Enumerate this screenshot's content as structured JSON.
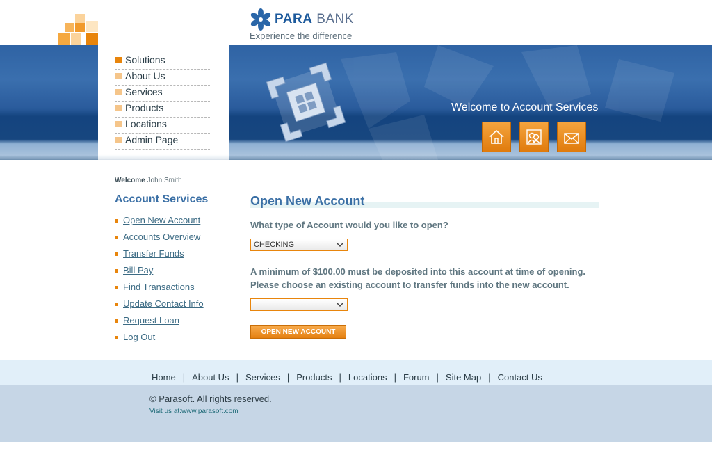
{
  "brand": {
    "name_part1": "PARA",
    "name_part2": " BANK",
    "tagline": "Experience the difference"
  },
  "top_nav": [
    {
      "label": "Solutions"
    },
    {
      "label": "About Us"
    },
    {
      "label": "Services"
    },
    {
      "label": "Products"
    },
    {
      "label": "Locations"
    },
    {
      "label": "Admin Page"
    }
  ],
  "banner": {
    "title": "Welcome to Account Services",
    "buttons": [
      {
        "icon": "home-icon"
      },
      {
        "icon": "contacts-icon"
      },
      {
        "icon": "mail-icon"
      }
    ]
  },
  "user": {
    "welcome_label": "Welcome",
    "name": "John Smith"
  },
  "account_services": {
    "title": "Account Services",
    "links": [
      {
        "label": "Open New Account"
      },
      {
        "label": "Accounts Overview"
      },
      {
        "label": "Transfer Funds"
      },
      {
        "label": "Bill Pay"
      },
      {
        "label": "Find Transactions"
      },
      {
        "label": "Update Contact Info"
      },
      {
        "label": "Request Loan"
      },
      {
        "label": "Log Out"
      }
    ]
  },
  "main": {
    "title": "Open New Account",
    "question": "What type of Account would you like to open?",
    "account_type_value": "CHECKING",
    "note_line1": "A minimum of $100.00 must be deposited into this account at time of opening.",
    "note_line2": "Please choose an existing account to transfer funds into the new account.",
    "from_account_value": "",
    "submit_label": "OPEN NEW ACCOUNT"
  },
  "footer": {
    "links": [
      {
        "label": "Home"
      },
      {
        "label": "About Us"
      },
      {
        "label": "Services"
      },
      {
        "label": "Products"
      },
      {
        "label": "Locations"
      },
      {
        "label": "Forum"
      },
      {
        "label": "Site Map"
      },
      {
        "label": "Contact Us"
      }
    ],
    "copyright": "© Parasoft. All rights reserved.",
    "visit": "Visit us at:www.parasoft.com"
  },
  "colors": {
    "accent": "#e8850c",
    "brand_blue": "#3a6fa5",
    "banner_blue": "#1f5296"
  }
}
